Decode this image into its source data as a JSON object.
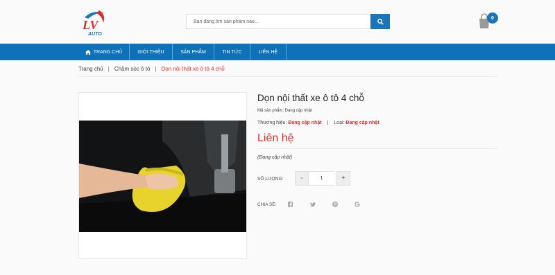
{
  "header": {
    "search_placeholder": "Bạn đang tìm sản phẩm nào...",
    "cart_count": "0"
  },
  "nav": {
    "items": [
      {
        "label": "TRANG CHỦ"
      },
      {
        "label": "GIỚI THIỆU"
      },
      {
        "label": "SẢN PHẨM"
      },
      {
        "label": "TIN TỨC"
      },
      {
        "label": "LIÊN HỆ"
      }
    ]
  },
  "breadcrumb": {
    "home": "Trang chủ",
    "category": "Chăm sóc ô tô",
    "current": "Dọn nội thất xe ô tô 4 chỗ",
    "separator": "|"
  },
  "product": {
    "title": "Dọn nội thất xe ô tô 4 chỗ",
    "sku": "Mã sản phẩm: Đang cập nhật",
    "brand_label": "Thương hiệu:",
    "brand_value": "Đang cập nhật",
    "type_label": "Loại:",
    "type_value": "Đang cập nhật",
    "price": "Liên hệ",
    "description": "(Đang cập nhật)",
    "quantity_label": "SỐ LƯỢNG:",
    "quantity_value": "1",
    "minus": "-",
    "plus": "+",
    "share_label": "CHIA SẺ:"
  },
  "colors": {
    "nav_blue": "#0d72b9",
    "accent_red": "#d92d2d"
  },
  "icons": [
    "home-icon",
    "search-icon",
    "cart-icon",
    "facebook-icon",
    "twitter-icon",
    "pinterest-icon",
    "google-icon"
  ]
}
